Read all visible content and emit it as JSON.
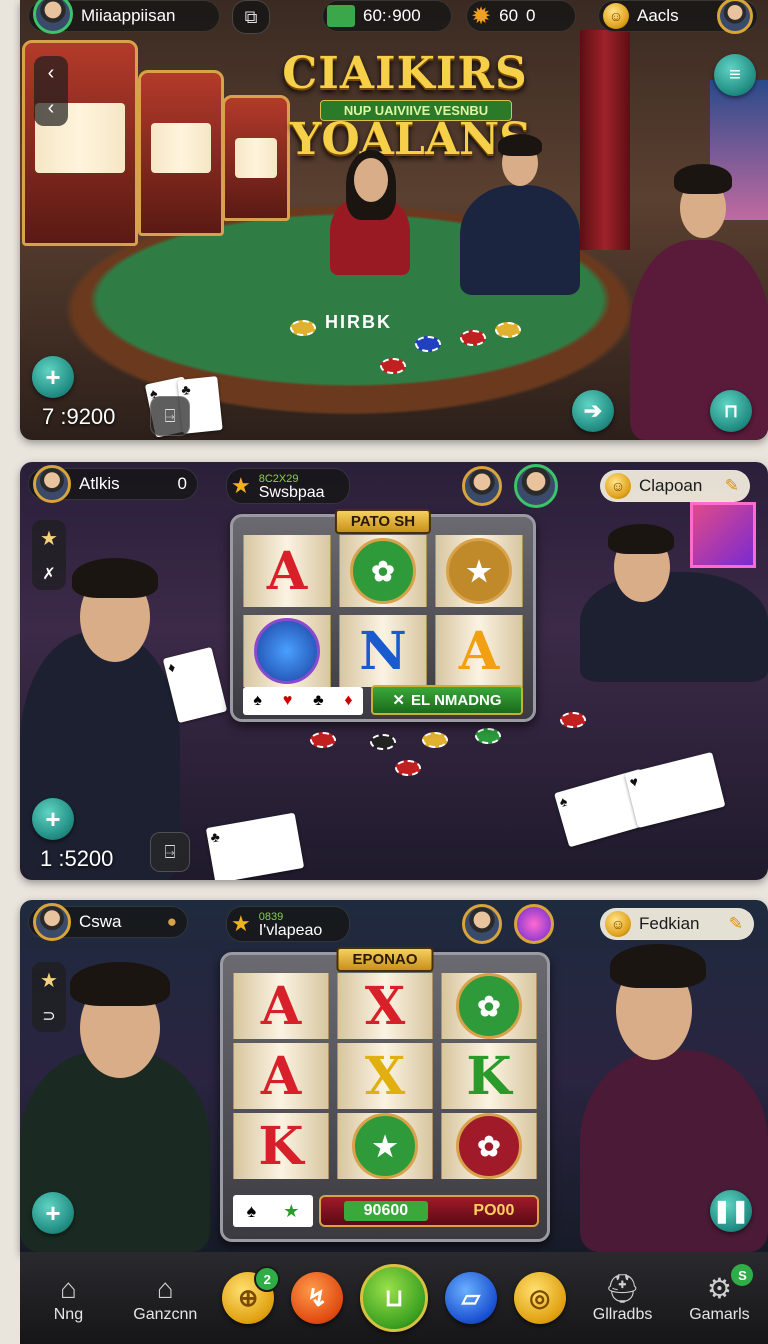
{
  "top_bar": {
    "player_name": "Miiaappiisan",
    "cash_amount": "60:·900",
    "gems_amount": "60",
    "gems_extra": "0",
    "right_name": "Aacls"
  },
  "table1": {
    "title_line1": "CIAIKIRS",
    "subtitle": "NUP UAIVIIVE VESNBU",
    "title_line2": "YOALANS",
    "table_text": "HIRBK",
    "score": "7 :9200"
  },
  "table2": {
    "player_name": "Atlkis",
    "player_value": "0",
    "promo_top": "8C2X29",
    "promo_name": "Swsbpaa",
    "right_name": "Clapoan",
    "slot_label": "PATO SH",
    "reels": [
      "A",
      "seal",
      "star",
      "orb",
      "N",
      "A"
    ],
    "action_label": "EL NMADNG",
    "score": "1 :5200"
  },
  "table3": {
    "player_name": "Cswa",
    "promo_top": "0839",
    "promo_name": "I'vlapeao",
    "right_name": "Fedkian",
    "slot_label": "EPONAO",
    "reels": [
      "A",
      "X",
      "seal",
      "A",
      "X",
      "K",
      "K",
      "star",
      "seal"
    ],
    "bet_value": "90600",
    "bet_label": "PO00"
  },
  "bottom_nav": {
    "items": [
      "Nng",
      "Ganzcnn",
      "Gllradbs",
      "Gamarls"
    ],
    "badge_count": "2",
    "badge_letter": "S"
  },
  "colors": {
    "felt": "#2f7d45",
    "accent_teal": "#1f8a80",
    "gold": "#f7d04a"
  }
}
